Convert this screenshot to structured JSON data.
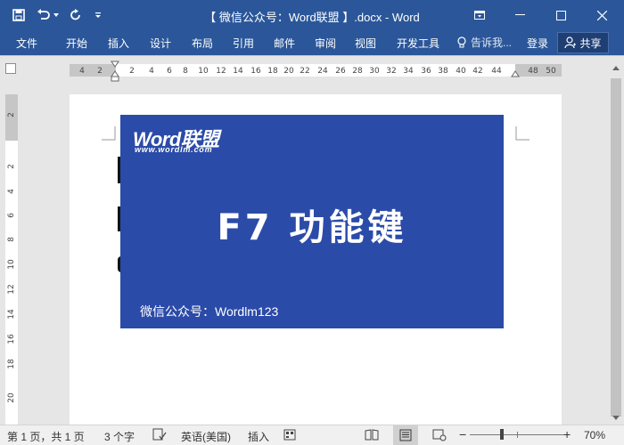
{
  "window": {
    "title": "【 微信公众号：Word联盟 】.docx - Word"
  },
  "ribbon": {
    "tabs": [
      "文件",
      "开始",
      "插入",
      "设计",
      "布局",
      "引用",
      "邮件",
      "审阅",
      "视图",
      "开发工具"
    ],
    "tell_me": "告诉我...",
    "sign_in": "登录",
    "share": "共享"
  },
  "ruler": {
    "h_ticks": [
      "4",
      "2",
      "2",
      "4",
      "6",
      "8",
      "10",
      "12",
      "14",
      "16",
      "18",
      "20",
      "22",
      "24",
      "26",
      "28",
      "30",
      "32",
      "34",
      "36",
      "38",
      "40",
      "42",
      "44",
      "48",
      "50"
    ],
    "v_ticks": [
      "2",
      "2",
      "4",
      "6",
      "8",
      "10",
      "12",
      "14",
      "16",
      "18",
      "20"
    ]
  },
  "document": {
    "image": {
      "logo": "Word联盟",
      "logo_url": "www.wordlm.com",
      "headline": "F7 功能键",
      "footer": "微信公众号：Wordlm123"
    }
  },
  "statusbar": {
    "page_info": "第 1 页，共 1 页",
    "word_count": "3 个字",
    "language": "英语(美国)",
    "mode": "插入",
    "zoom_level": "70%",
    "zoom_minus": "−",
    "zoom_plus": "+"
  },
  "colors": {
    "word_blue": "#2b579a",
    "banner_blue": "#2b4ba8"
  }
}
